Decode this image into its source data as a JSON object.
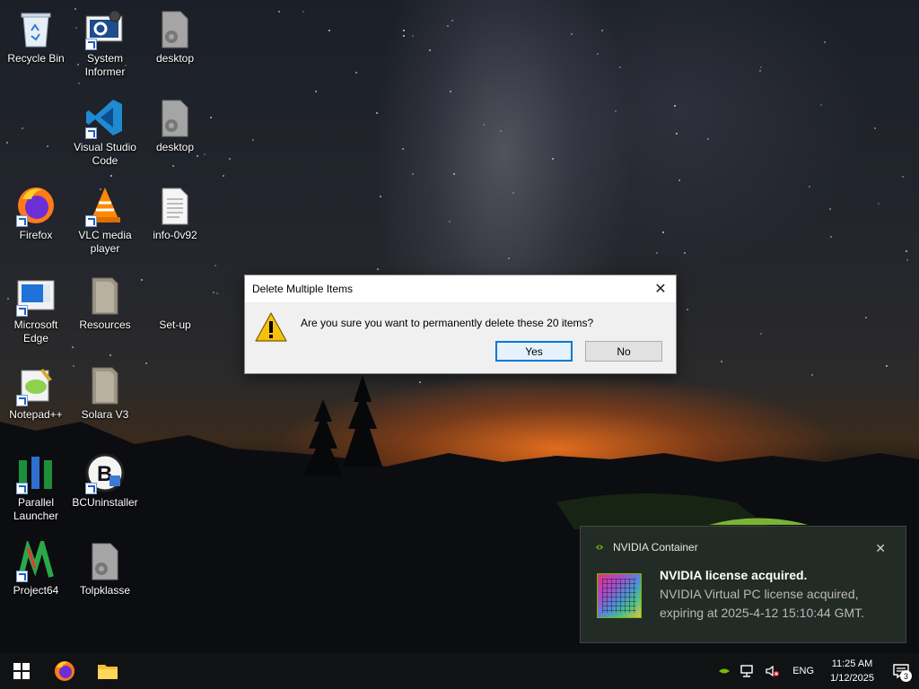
{
  "desktop": {
    "icons": [
      {
        "label": "Recycle Bin",
        "icon": "recycle-bin-icon"
      },
      {
        "label": "System Informer",
        "icon": "system-informer-icon"
      },
      {
        "label": "desktop",
        "icon": "settings-file-icon"
      },
      {
        "label": "Visual Studio Code",
        "icon": "vscode-icon"
      },
      {
        "label": "desktop",
        "icon": "settings-file-icon"
      },
      {
        "label": "Firefox",
        "icon": "firefox-icon"
      },
      {
        "label": "VLC media player",
        "icon": "vlc-icon"
      },
      {
        "label": "info-0v92",
        "icon": "text-file-icon"
      },
      {
        "label": "Microsoft Edge",
        "icon": "edge-icon"
      },
      {
        "label": "Resources",
        "icon": "folder-icon"
      },
      {
        "label": "Set-up",
        "icon": "setup-icon"
      },
      {
        "label": "Notepad++",
        "icon": "notepadpp-icon"
      },
      {
        "label": "Solara V3",
        "icon": "folder-icon"
      },
      {
        "label": "Parallel Launcher",
        "icon": "parallel-launcher-icon"
      },
      {
        "label": "BCUninstaller",
        "icon": "bcuninstaller-icon"
      },
      {
        "label": "Project64",
        "icon": "project64-icon"
      },
      {
        "label": "Tolpklasse",
        "icon": "settings-file-icon"
      }
    ]
  },
  "dialog": {
    "title": "Delete Multiple Items",
    "close_glyph": "✕",
    "message": "Are you sure you want to permanently delete these 20 items?",
    "yes_label": "Yes",
    "no_label": "No",
    "icon": "warning-icon"
  },
  "notification": {
    "app_name": "NVIDIA Container",
    "close_glyph": "✕",
    "title": "NVIDIA license acquired.",
    "body": "NVIDIA Virtual PC license acquired, expiring at 2025-4-12 15:10:44 GMT.",
    "accent": "#76b900"
  },
  "taskbar": {
    "start_icon": "windows-start-icon",
    "pinned": [
      "firefox-icon",
      "file-explorer-icon"
    ],
    "tray": {
      "language": "ENG",
      "time": "11:25 AM",
      "date": "1/12/2025",
      "notification_count": "3"
    }
  }
}
